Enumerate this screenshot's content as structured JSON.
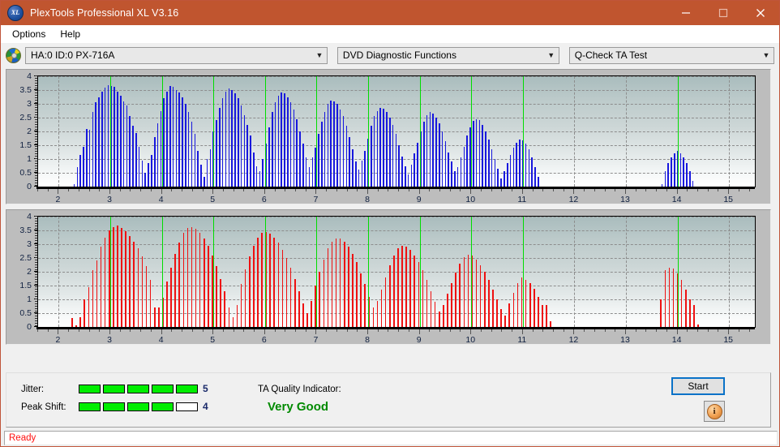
{
  "window": {
    "title": "PlexTools Professional XL V3.16",
    "app_icon": "xl-logo-icon",
    "minimize_label": "Minimize",
    "maximize_label": "Maximize",
    "close_label": "Close",
    "accent_color": "#c0552f"
  },
  "menu": {
    "items": [
      {
        "label": "Options"
      },
      {
        "label": "Help"
      }
    ]
  },
  "selectors": {
    "drive": {
      "value": "HA:0 ID:0  PX-716A",
      "icon": "disc-icon"
    },
    "function": {
      "value": "DVD Diagnostic Functions"
    },
    "test": {
      "value": "Q-Check TA Test"
    }
  },
  "results": {
    "jitter_label": "Jitter:",
    "jitter_value": "5",
    "jitter_filled": 5,
    "jitter_total": 5,
    "peak_shift_label": "Peak Shift:",
    "peak_shift_value": "4",
    "peak_shift_filled": 4,
    "peak_shift_total": 5,
    "ta_quality_label": "TA Quality Indicator:",
    "ta_quality_value": "Very Good",
    "ta_quality_color": "#008a00",
    "start_label": "Start",
    "info_label": "i",
    "meter_on_color": "#00ee00"
  },
  "status": {
    "text": "Ready",
    "color": "#ff1010"
  },
  "chart_data": [
    {
      "id": "jitter-chart",
      "type": "bar",
      "title": "",
      "xlabel": "",
      "ylabel": "",
      "series_color": "#1818dd",
      "ylim": [
        0,
        4
      ],
      "xlim": [
        1.6,
        15.5
      ],
      "yticks": [
        0,
        0.5,
        1,
        1.5,
        2,
        2.5,
        3,
        3.5,
        4
      ],
      "ytick_labels": [
        "0",
        "0.5",
        "1",
        "1.5",
        "2",
        "2.5",
        "3",
        "3.5",
        "4"
      ],
      "xticks": [
        2,
        3,
        4,
        5,
        6,
        7,
        8,
        9,
        10,
        11,
        12,
        13,
        14,
        15
      ],
      "xtick_labels": [
        "2",
        "3",
        "4",
        "5",
        "6",
        "7",
        "8",
        "9",
        "10",
        "11",
        "12",
        "13",
        "14",
        "15"
      ],
      "grid": true,
      "marker_lines": [
        3,
        4,
        5,
        6,
        7,
        8,
        9,
        10,
        11,
        14
      ],
      "marker_color": "#00dd00",
      "bar_width": 0.022,
      "x": [
        2.3,
        2.36,
        2.42,
        2.48,
        2.54,
        2.6,
        2.66,
        2.72,
        2.78,
        2.84,
        2.9,
        2.96,
        3.02,
        3.08,
        3.14,
        3.2,
        3.26,
        3.32,
        3.38,
        3.44,
        3.5,
        3.56,
        3.62,
        3.68,
        3.74,
        3.8,
        3.86,
        3.92,
        3.98,
        4.04,
        4.1,
        4.16,
        4.22,
        4.28,
        4.34,
        4.4,
        4.46,
        4.52,
        4.58,
        4.64,
        4.7,
        4.76,
        4.82,
        4.88,
        4.94,
        5.0,
        5.06,
        5.12,
        5.18,
        5.24,
        5.3,
        5.36,
        5.42,
        5.48,
        5.54,
        5.6,
        5.66,
        5.72,
        5.78,
        5.84,
        5.9,
        5.96,
        6.02,
        6.08,
        6.14,
        6.2,
        6.26,
        6.32,
        6.38,
        6.44,
        6.5,
        6.56,
        6.62,
        6.68,
        6.74,
        6.8,
        6.86,
        6.92,
        6.98,
        7.04,
        7.1,
        7.16,
        7.22,
        7.28,
        7.34,
        7.4,
        7.46,
        7.52,
        7.58,
        7.64,
        7.7,
        7.76,
        7.82,
        7.88,
        7.94,
        8.0,
        8.06,
        8.12,
        8.18,
        8.24,
        8.3,
        8.36,
        8.42,
        8.48,
        8.54,
        8.6,
        8.66,
        8.72,
        8.78,
        8.84,
        8.9,
        8.96,
        9.02,
        9.08,
        9.14,
        9.2,
        9.26,
        9.32,
        9.38,
        9.44,
        9.5,
        9.56,
        9.62,
        9.68,
        9.74,
        9.8,
        9.86,
        9.92,
        9.98,
        10.04,
        10.1,
        10.16,
        10.22,
        10.28,
        10.34,
        10.4,
        10.46,
        10.52,
        10.58,
        10.64,
        10.7,
        10.76,
        10.82,
        10.88,
        10.94,
        11.0,
        11.06,
        11.12,
        11.18,
        11.24,
        11.3,
        13.7,
        13.76,
        13.82,
        13.88,
        13.94,
        14.0,
        14.06,
        14.12,
        14.18,
        14.24,
        14.3
      ],
      "y": [
        0.1,
        0.72,
        1.15,
        1.45,
        2.1,
        2.05,
        2.7,
        3.05,
        3.25,
        3.45,
        3.6,
        3.68,
        3.65,
        3.62,
        3.45,
        3.3,
        3.1,
        2.95,
        2.55,
        2.2,
        1.95,
        1.45,
        0.95,
        0.5,
        0.85,
        1.15,
        1.8,
        2.3,
        2.75,
        3.2,
        3.45,
        3.65,
        3.62,
        3.5,
        3.4,
        3.25,
        3.0,
        2.7,
        2.35,
        1.9,
        1.3,
        0.8,
        0.35,
        1.0,
        1.35,
        2.0,
        2.4,
        2.85,
        3.2,
        3.45,
        3.55,
        3.5,
        3.38,
        3.2,
        2.95,
        2.6,
        2.25,
        1.85,
        1.25,
        0.75,
        0.55,
        1.0,
        1.55,
        2.15,
        2.7,
        3.05,
        3.3,
        3.4,
        3.38,
        3.25,
        3.05,
        2.8,
        2.45,
        2.0,
        1.55,
        1.05,
        0.7,
        1.05,
        1.4,
        1.9,
        2.35,
        2.7,
        3.0,
        3.12,
        3.1,
        3.0,
        2.8,
        2.55,
        2.2,
        1.8,
        1.35,
        0.9,
        0.62,
        0.95,
        1.3,
        1.75,
        2.2,
        2.55,
        2.75,
        2.85,
        2.82,
        2.7,
        2.5,
        2.25,
        1.9,
        1.5,
        1.1,
        0.75,
        0.45,
        0.8,
        1.2,
        1.6,
        2.0,
        2.35,
        2.6,
        2.7,
        2.65,
        2.5,
        2.3,
        2.0,
        1.65,
        1.25,
        0.9,
        0.55,
        0.7,
        1.05,
        1.45,
        1.85,
        2.15,
        2.38,
        2.45,
        2.4,
        2.25,
        2.0,
        1.7,
        1.35,
        1.0,
        0.65,
        0.3,
        0.55,
        0.85,
        1.15,
        1.4,
        1.6,
        1.7,
        1.68,
        1.55,
        1.35,
        1.05,
        0.7,
        0.35,
        0.1,
        0.55,
        0.85,
        1.05,
        1.2,
        1.28,
        1.22,
        1.05,
        0.85,
        0.55,
        0.2
      ]
    },
    {
      "id": "peak-shift-chart",
      "type": "bar",
      "title": "",
      "xlabel": "",
      "ylabel": "",
      "series_color": "#ee1111",
      "ylim": [
        0,
        4
      ],
      "xlim": [
        1.6,
        15.5
      ],
      "yticks": [
        0,
        0.5,
        1,
        1.5,
        2,
        2.5,
        3,
        3.5,
        4
      ],
      "ytick_labels": [
        "0",
        "0.5",
        "1",
        "1.5",
        "2",
        "2.5",
        "3",
        "3.5",
        "4"
      ],
      "xticks": [
        2,
        3,
        4,
        5,
        6,
        7,
        8,
        9,
        10,
        11,
        12,
        13,
        14,
        15
      ],
      "xtick_labels": [
        "2",
        "3",
        "4",
        "5",
        "6",
        "7",
        "8",
        "9",
        "10",
        "11",
        "12",
        "13",
        "14",
        "15"
      ],
      "grid": true,
      "marker_lines": [
        3,
        4,
        5,
        6,
        7,
        8,
        9,
        10,
        11,
        14
      ],
      "marker_color": "#00dd00",
      "bar_width": 0.014,
      "x": [
        2.26,
        2.34,
        2.42,
        2.5,
        2.58,
        2.66,
        2.74,
        2.82,
        2.9,
        2.98,
        3.06,
        3.14,
        3.22,
        3.3,
        3.38,
        3.46,
        3.54,
        3.62,
        3.7,
        3.78,
        3.86,
        3.94,
        4.02,
        4.1,
        4.18,
        4.26,
        4.34,
        4.42,
        4.5,
        4.58,
        4.66,
        4.74,
        4.82,
        4.9,
        4.98,
        5.06,
        5.14,
        5.22,
        5.3,
        5.38,
        5.46,
        5.54,
        5.62,
        5.7,
        5.78,
        5.86,
        5.94,
        6.02,
        6.1,
        6.18,
        6.26,
        6.34,
        6.42,
        6.5,
        6.58,
        6.66,
        6.74,
        6.82,
        6.9,
        6.98,
        7.06,
        7.14,
        7.22,
        7.3,
        7.38,
        7.46,
        7.54,
        7.62,
        7.7,
        7.78,
        7.86,
        7.94,
        8.02,
        8.1,
        8.18,
        8.26,
        8.34,
        8.42,
        8.5,
        8.58,
        8.66,
        8.74,
        8.82,
        8.9,
        8.98,
        9.06,
        9.14,
        9.22,
        9.3,
        9.38,
        9.46,
        9.54,
        9.62,
        9.7,
        9.78,
        9.86,
        9.94,
        10.02,
        10.1,
        10.18,
        10.26,
        10.34,
        10.42,
        10.5,
        10.58,
        10.66,
        10.74,
        10.82,
        10.9,
        10.98,
        11.06,
        11.14,
        11.22,
        11.3,
        11.38,
        11.46,
        11.54,
        13.68,
        13.76,
        13.84,
        13.92,
        14.0,
        14.08,
        14.16,
        14.24,
        14.32,
        14.4
      ],
      "y": [
        0.33,
        0.05,
        0.35,
        1.0,
        1.45,
        2.05,
        2.4,
        2.9,
        3.25,
        3.5,
        3.62,
        3.68,
        3.6,
        3.48,
        3.3,
        3.1,
        2.85,
        2.55,
        2.2,
        1.7,
        0.7,
        0.7,
        1.05,
        1.65,
        2.15,
        2.65,
        3.05,
        3.4,
        3.6,
        3.62,
        3.55,
        3.42,
        3.2,
        2.95,
        2.6,
        2.2,
        1.75,
        1.3,
        0.7,
        0.35,
        0.8,
        1.55,
        2.1,
        2.55,
        2.95,
        3.25,
        3.4,
        3.45,
        3.38,
        3.25,
        3.05,
        2.8,
        2.5,
        2.15,
        1.75,
        1.3,
        0.85,
        0.5,
        0.95,
        1.5,
        2.0,
        2.45,
        2.85,
        3.1,
        3.22,
        3.2,
        3.08,
        2.9,
        2.65,
        2.35,
        1.95,
        1.55,
        1.1,
        0.7,
        0.95,
        1.35,
        1.8,
        2.25,
        2.6,
        2.85,
        2.95,
        2.92,
        2.8,
        2.6,
        2.35,
        2.05,
        1.7,
        1.3,
        0.9,
        0.55,
        0.8,
        1.2,
        1.6,
        1.98,
        2.3,
        2.52,
        2.62,
        2.58,
        2.45,
        2.25,
        2.0,
        1.7,
        1.35,
        1.0,
        0.65,
        0.4,
        0.85,
        1.25,
        1.58,
        1.78,
        1.72,
        1.58,
        1.38,
        1.1,
        0.8,
        0.78,
        0.2,
        1.0,
        2.05,
        2.15,
        2.12,
        1.95,
        1.7,
        1.35,
        1.0,
        0.8,
        0.1
      ]
    }
  ]
}
